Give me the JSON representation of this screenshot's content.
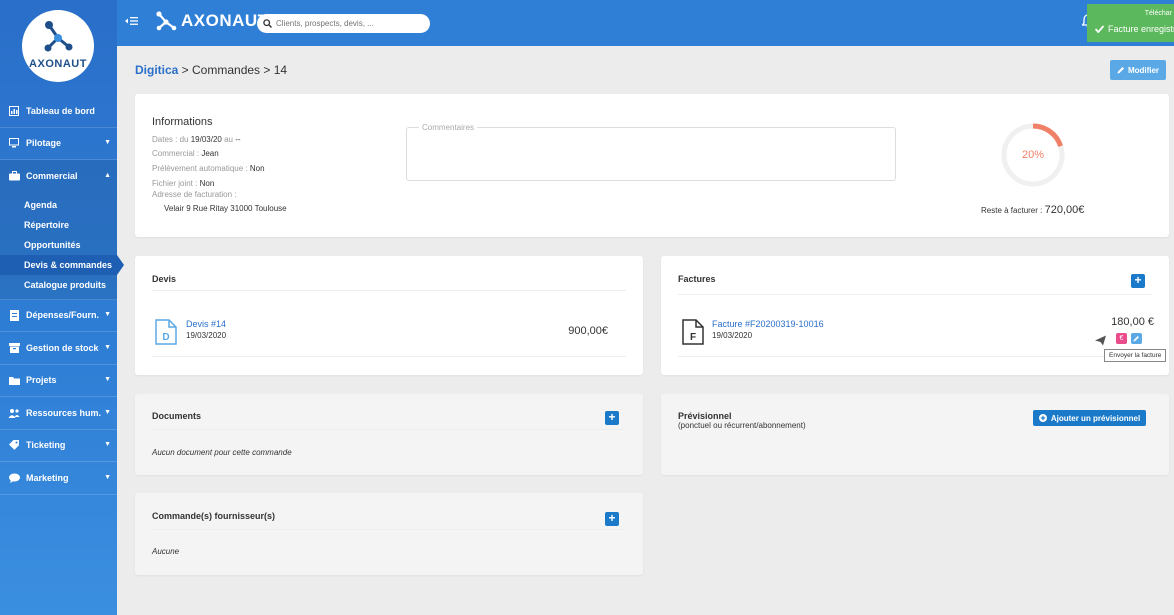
{
  "app": {
    "brand": "AXONAUT",
    "logo_text": "AXONAUT"
  },
  "colors": {
    "primary": "#2f7fd6",
    "accent_button": "#1a7ac9",
    "gauge": "#f08068",
    "toast": "#5cb85c"
  },
  "search": {
    "placeholder": "Clients, prospects, devis, ..."
  },
  "toast": {
    "top": "Téléchar",
    "message": "Facture enregistr"
  },
  "sidebar": {
    "items": [
      {
        "label": "Tableau de bord",
        "icon": "dashboard-icon"
      },
      {
        "label": "Pilotage",
        "icon": "monitor-icon"
      },
      {
        "label": "Commercial",
        "icon": "briefcase-icon"
      },
      {
        "label": "Dépenses/Fourn.",
        "icon": "receipt-icon"
      },
      {
        "label": "Gestion de stock",
        "icon": "box-icon"
      },
      {
        "label": "Projets",
        "icon": "folder-icon"
      },
      {
        "label": "Ressources hum.",
        "icon": "users-icon"
      },
      {
        "label": "Ticketing",
        "icon": "ticket-icon"
      },
      {
        "label": "Marketing",
        "icon": "chat-icon"
      }
    ],
    "sub_items": [
      {
        "label": "Agenda"
      },
      {
        "label": "Répertoire"
      },
      {
        "label": "Opportunités"
      },
      {
        "label": "Devis & commandes"
      },
      {
        "label": "Catalogue produits"
      }
    ]
  },
  "breadcrumb": {
    "link": "Digitica",
    "rest": " > Commandes > 14"
  },
  "header": {
    "modifier_label": "Modifier"
  },
  "info": {
    "title": "Informations",
    "dates_label": "Dates : du",
    "dates_value": "19/03/20",
    "dates_suffix_label": "au",
    "dates_suffix_value": "--",
    "commercial_label": "Commercial :",
    "commercial_value": "Jean",
    "prelevement_label": "Prélèvement automatique :",
    "prelevement_value": "Non",
    "fichier_label": "Fichier joint :",
    "fichier_value": "Non",
    "adresse_label": "Adresse de facturation :",
    "adresse_value": "Velair 9 Rue Ritay 31000 Toulouse",
    "comments_label": "Commentaires",
    "progress_text": "20%",
    "progress_fraction": 0.2,
    "reste_label": "Reste à facturer :",
    "reste_value": "720,00€"
  },
  "devis": {
    "title": "Devis",
    "item_link": "Devis #14",
    "item_date": "19/03/2020",
    "item_amount": "900,00€",
    "icon_letter": "D"
  },
  "factures": {
    "title": "Factures",
    "item_link": "Facture #F20200319-10016",
    "item_date": "19/03/2020",
    "item_amount": "180,00 €",
    "icon_letter": "F",
    "tooltip": "Envoyer la facture",
    "euro_symbol": "€"
  },
  "documents": {
    "title": "Documents",
    "empty": "Aucun document pour cette commande"
  },
  "previsionnel": {
    "title": "Prévisionnel",
    "subtitle": "(ponctuel ou récurrent/abonnement)",
    "button": "Ajouter un prévisionnel"
  },
  "commandes_fournisseurs": {
    "title": "Commande(s) fournisseur(s)",
    "empty": "Aucune"
  }
}
